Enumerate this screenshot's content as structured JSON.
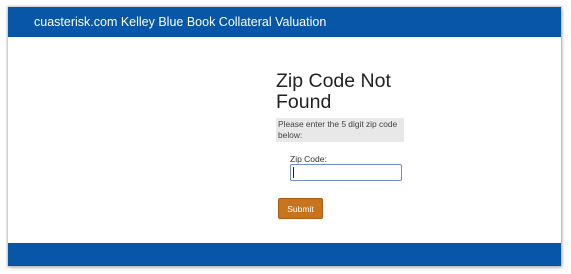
{
  "header": {
    "title": "cuasterisk.com Kelley Blue Book Collateral Valuation"
  },
  "main": {
    "title": "Zip Code Not Found",
    "instructions": "Please enter the 5 digit zip code below:",
    "zip_label": "Zip Code:",
    "zip_value": "",
    "submit_label": "Submit"
  },
  "colors": {
    "brand_blue": "#0756a8",
    "submit_orange": "#c8741f",
    "instruction_bg": "#e8e8e8",
    "input_border": "#6c8fc9"
  }
}
